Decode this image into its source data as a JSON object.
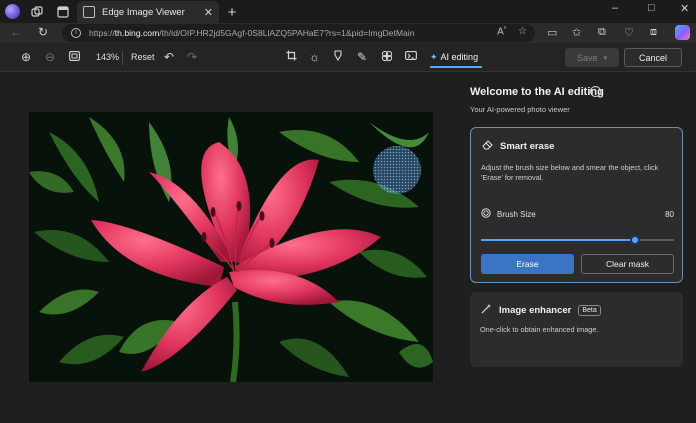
{
  "browser": {
    "tab_title": "Edge Image Viewer",
    "new_tab_symbol": "+",
    "url_prefix": "https://",
    "url_domain": "th.bing.com",
    "url_path": "/th/id/OIP.HR2jd5GAgf-0S8LlAZQ5PAHaE7?rs=1&pid=ImgDetMain",
    "window_controls": [
      "–",
      "□",
      "✕"
    ],
    "icons": {
      "profile": "profile-avatar-icon",
      "workspaces": "workspaces-icon",
      "tab_actions": "tab-actions-icon",
      "tab_favicon": "image-viewer-favicon-icon",
      "close_tab": "close-icon",
      "back": "back-arrow-icon",
      "refresh": "refresh-icon",
      "site_info": "info-icon",
      "read_aloud": "read-aloud-icon",
      "favorite": "star-icon",
      "split_screen": "split-screen-icon",
      "favorites": "favorites-icon",
      "collections": "collections-icon",
      "browser_essentials": "heart-pulse-icon",
      "extensions": "extensions-icon",
      "copilot": "copilot-icon"
    }
  },
  "toolbar": {
    "zoom_level": "143%",
    "reset_label": "Reset",
    "ai_editing_label": "AI editing",
    "save_label": "Save",
    "cancel_label": "Cancel",
    "icons": [
      "zoom-in-icon",
      "zoom-out-icon",
      "fit-to-screen-icon",
      "undo-icon",
      "redo-icon",
      "crop-icon",
      "brightness-icon",
      "markup-icon",
      "draw-icon",
      "filters-icon",
      "effects-icon",
      "sparkle-icon",
      "chevron-down-icon"
    ]
  },
  "panel": {
    "title": "Welcome to the AI editing",
    "subtitle": "Your AI-powered photo viewer",
    "smart_erase": {
      "title": "Smart erase",
      "description": "Adjust the brush size below and smear the object, click 'Erase' for removal.",
      "brush_label": "Brush Size",
      "brush_value": "80",
      "brush_fraction": 0.8,
      "erase_label": "Erase",
      "clear_label": "Clear mask"
    },
    "enhancer": {
      "title": "Image enhancer",
      "badge": "Beta",
      "description": "One-click to obtain enhanced image."
    }
  },
  "colors": {
    "accent": "#5aa3ff",
    "erase_button": "#3b74c3",
    "lily": "#e0355e",
    "foliage": "#2f6a24"
  }
}
